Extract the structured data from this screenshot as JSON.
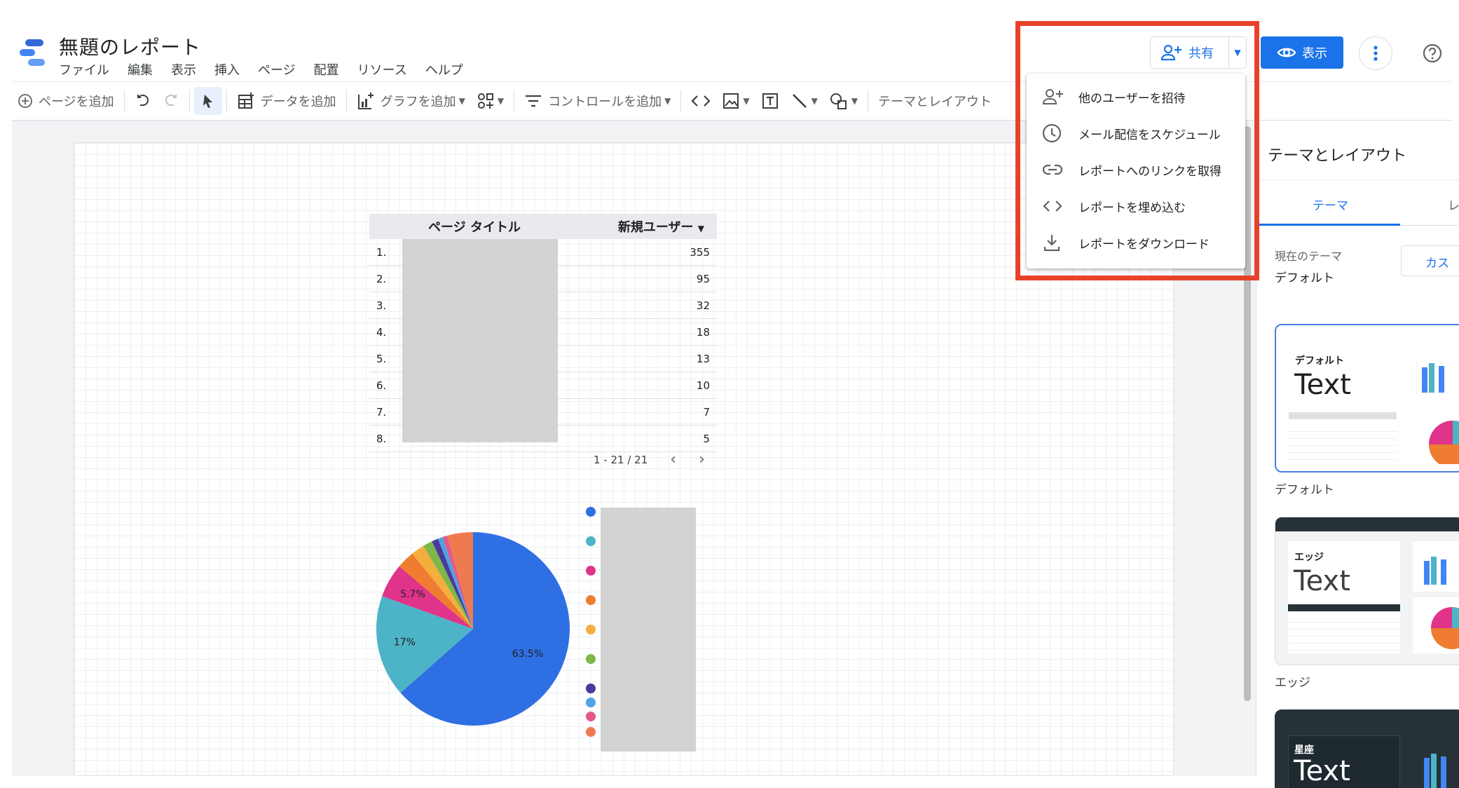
{
  "header": {
    "title": "無題のレポート",
    "menu": [
      "ファイル",
      "編集",
      "表示",
      "挿入",
      "ページ",
      "配置",
      "リソース",
      "ヘルプ"
    ]
  },
  "toolbar": {
    "add_page": "ページを追加",
    "add_data": "データを追加",
    "add_chart": "グラフを追加",
    "add_control": "コントロールを追加",
    "theme_layout": "テーマとレイアウト"
  },
  "top_actions": {
    "share": "共有",
    "view": "表示"
  },
  "share_menu": {
    "items": [
      {
        "label": "他のユーザーを招待",
        "icon": "person-add-icon"
      },
      {
        "label": "メール配信をスケジュール",
        "icon": "clock-icon"
      },
      {
        "label": "レポートへのリンクを取得",
        "icon": "link-icon"
      },
      {
        "label": "レポートを埋め込む",
        "icon": "code-icon"
      },
      {
        "label": "レポートをダウンロード",
        "icon": "download-icon"
      }
    ]
  },
  "table": {
    "col_title": "ページ タイトル",
    "col_users": "新規ユーザー",
    "rows": [
      {
        "idx": "1.",
        "value": "355"
      },
      {
        "idx": "2.",
        "value": "95"
      },
      {
        "idx": "3.",
        "value": "32"
      },
      {
        "idx": "4.",
        "value": "18"
      },
      {
        "idx": "5.",
        "value": "13"
      },
      {
        "idx": "6.",
        "value": "10"
      },
      {
        "idx": "7.",
        "value": "7"
      },
      {
        "idx": "8.",
        "value": "5"
      }
    ],
    "pagination": "1 - 21 / 21"
  },
  "chart_data": {
    "type": "pie",
    "slices": [
      {
        "value": 63.5,
        "label": "63.5%",
        "color": "#2f6fe4"
      },
      {
        "value": 17,
        "label": "17%",
        "color": "#4db3c6"
      },
      {
        "value": 5.7,
        "label": "5.7%",
        "color": "#e0338a"
      },
      {
        "value": 3.0,
        "label": "",
        "color": "#ef7c30"
      },
      {
        "value": 2.2,
        "label": "",
        "color": "#f4ae3d"
      },
      {
        "value": 1.6,
        "label": "",
        "color": "#7db749"
      },
      {
        "value": 1.1,
        "label": "",
        "color": "#4b3a9c"
      },
      {
        "value": 0.8,
        "label": "",
        "color": "#4ea3e4"
      },
      {
        "value": 0.8,
        "label": "",
        "color": "#e05a8c"
      },
      {
        "value": 4.3,
        "label": "",
        "color": "#f07a50"
      }
    ]
  },
  "panel": {
    "title": "テーマとレイアウト",
    "tab_theme": "テーマ",
    "tab_layout": "レ",
    "current_theme_label": "現在のテーマ",
    "current_theme_value": "デフォルト",
    "customize": "カス",
    "themes": [
      {
        "small": "デフォルト",
        "big": "Text",
        "caption": "デフォルト"
      },
      {
        "small": "エッジ",
        "big": "Text",
        "caption": "エッジ"
      },
      {
        "small": "星座",
        "big": "Text",
        "caption": ""
      }
    ]
  },
  "colors": {
    "accent": "#1a73e8",
    "highlight": "#e8412a"
  }
}
